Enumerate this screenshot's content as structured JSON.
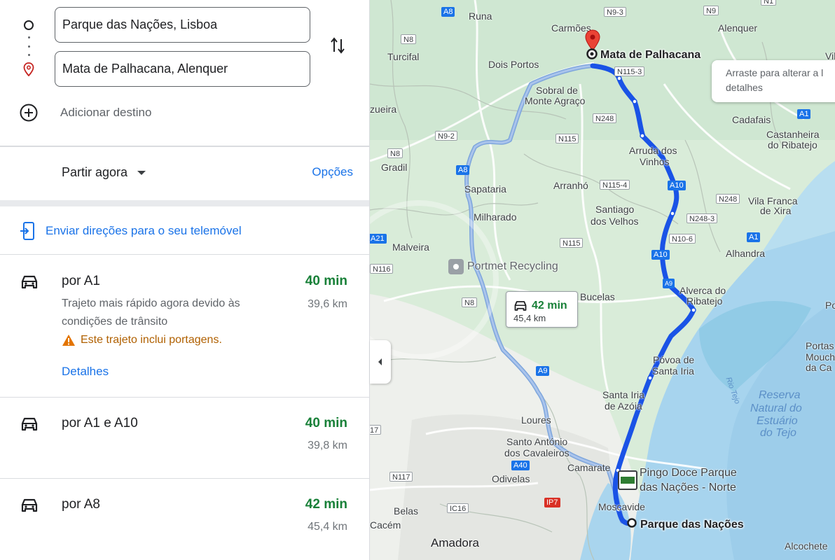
{
  "directions": {
    "origin_value": "Parque das Nações, Lisboa",
    "destination_value": "Mata de Palhacana, Alenquer",
    "add_destination_label": "Adicionar destino",
    "depart_label": "Partir agora",
    "options_label": "Opções",
    "send_label": "Enviar direções para o seu telemóvel"
  },
  "routes": [
    {
      "name": "por A1",
      "time": "40 min",
      "distance": "39,6 km",
      "description": "Trajeto mais rápido agora devido às condições de trânsito",
      "warning": "Este trajeto inclui portagens.",
      "details_label": "Detalhes"
    },
    {
      "name": "por A1 e A10",
      "time": "40 min",
      "distance": "39,8 km"
    },
    {
      "name": "por A8",
      "time": "42 min",
      "distance": "45,4 km"
    }
  ],
  "map": {
    "tooltip": "Arraste para alterar a l detalhes",
    "tooltip_line1": "Arraste para alterar a l",
    "tooltip_line2": "detalhes",
    "alt_route_time": "42 min",
    "alt_route_distance": "45,4 km",
    "destination_label": "Mata de Palhacana",
    "origin_label": "Parque das Nações",
    "poi_recycling": "Portmet Recycling",
    "poi_pingo_doce_1": "Pingo Doce Parque",
    "poi_pingo_doce_2": "das Nações - Norte",
    "place_labels": {
      "runa": "Runa",
      "carmoes": "Carmões",
      "alenquer": "Alenquer",
      "turcifal": "Turcifal",
      "dois_portos": "Dois Portos",
      "sobral1": "Sobral de",
      "sobral2": "Monte Agraço",
      "zueira": "zueira",
      "cadafais": "Cadafais",
      "castanheira1": "Castanheira",
      "castanheira2": "do Ribatejo",
      "gradil": "Gradil",
      "arruda1": "Arruda dos",
      "arruda2": "Vinhos",
      "sapataria": "Sapataria",
      "arranho": "Arranhó",
      "vila_franca1": "Vila Franca",
      "vila_franca2": "de Xira",
      "santiago1": "Santiago",
      "santiago2": "dos Velhos",
      "milharado": "Milharado",
      "alhandra": "Alhandra",
      "malveira": "Malveira",
      "alverca1": "Alverca do",
      "alverca2": "Ribatejo",
      "bucelas": "Bucelas",
      "povoa1": "Póvoa de",
      "povoa2": "Santa Iria",
      "santa_iria1": "Santa Iria",
      "santa_iria2": "de Azóia",
      "loures": "Loures",
      "santo_antonio1": "Santo António",
      "santo_antonio2": "dos Cavaleiros",
      "camarate": "Camarate",
      "odivelas": "Odivelas",
      "moscavide": "Moscavide",
      "belas": "Belas",
      "cacem": "Cacém",
      "amadora": "Amadora",
      "alcochete": "Alcochete",
      "portas1": "Portas",
      "portas2": "Mouch",
      "portas3": "da Ca",
      "vil": "Vil",
      "po": "Po",
      "rio_tejo": "Rio Tejo",
      "reserva1": "Reserva",
      "reserva2": "Natural do",
      "reserva3": "Estuário",
      "reserva4": "do Tejo"
    },
    "shields": {
      "a8_top": "A8",
      "n9_3": "N9-3",
      "n9": "N9",
      "n1": "N1",
      "n8_top": "N8",
      "n115_3": "N115-3",
      "n248": "N248",
      "a1_right": "A1",
      "n9_2": "N9-2",
      "n115": "N115",
      "n8_left": "N8",
      "a8_mid": "A8",
      "a10_1": "A10",
      "n115_4": "N115-4",
      "n248_b": "N248",
      "n248_3": "N248-3",
      "a21": "A21",
      "n10_6": "N10-6",
      "a1_alhandra": "A1",
      "n116": "N116",
      "n115_b": "N115",
      "a10_2": "A10",
      "a9_route": "A9",
      "n8_b": "N8",
      "a9": "A9",
      "n17": "17",
      "a40": "A40",
      "n117": "N117",
      "ic16": "IC16",
      "ip7": "IP7"
    }
  },
  "colors": {
    "accent": "#1a73e8",
    "route_green": "#188038",
    "warning": "#b06000",
    "route_line": "#1a53e6"
  }
}
